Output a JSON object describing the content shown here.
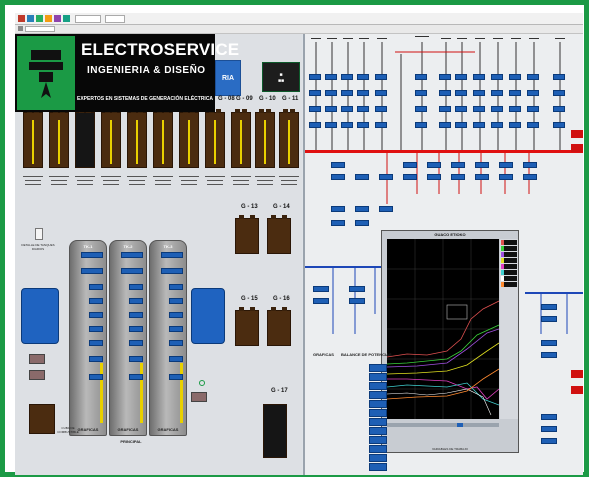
{
  "logo": {
    "brand": "ELECTROSERVICE",
    "subtitle": "INGENIERIA & DISEÑO",
    "tagline": "EXPERTOS EN SISTEMAS DE GENERACIÓN ELÉCTRICA"
  },
  "header": {
    "partial_title": "RIA"
  },
  "left": {
    "gen_labels": [
      "G - 08",
      "G - 09",
      "G - 10",
      "G - 11"
    ],
    "gen_labels_mid": [
      "G - 13",
      "G - 14"
    ],
    "gen_labels_low": [
      "G - 15",
      "G - 16"
    ],
    "gen_label_bottom": "G - 17",
    "silos": [
      "TK-1",
      "TK-2",
      "TK-3"
    ],
    "silo_foot": "GRAFICAS",
    "bottom_center": "PRINCIPAL",
    "bottom_left": "CUBA DE COMBUSTIBLE",
    "detail_label": "DETALLE DE TANQUES DIARIOS"
  },
  "right": {
    "graph_title": "GUACO ETIOKO",
    "graph_foot": "VARIABLES DE TRABAJO",
    "balance_title": "BALANCE DE POTENCIAS",
    "graphs_label": "GRAFICAS"
  },
  "colors": {
    "frame": "#1b9a45",
    "bus_red": "#e01010",
    "bus_blue": "#1d47b7",
    "panel_blue": "#1f63c0",
    "gen_brown": "#4b2c10"
  }
}
